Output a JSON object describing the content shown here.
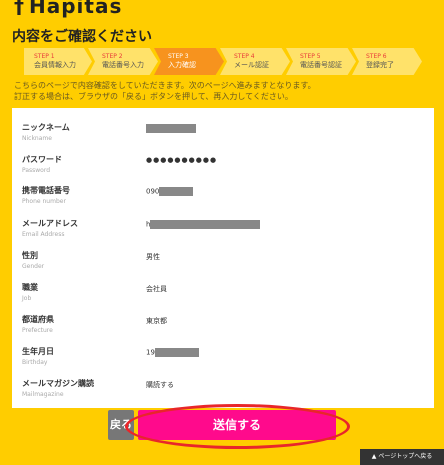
{
  "header": {
    "logo_mark": "†",
    "logo_text": "Hapitas",
    "page_title": "内容をご確認ください"
  },
  "steps": [
    {
      "num": "STEP 1",
      "label": "会員情報入力"
    },
    {
      "num": "STEP 2",
      "label": "電話番号入力"
    },
    {
      "num": "STEP 3",
      "label": "入力確認"
    },
    {
      "num": "STEP 4",
      "label": "メール認証"
    },
    {
      "num": "STEP 5",
      "label": "電話番号認証"
    },
    {
      "num": "STEP 6",
      "label": "登録完了"
    }
  ],
  "notice": {
    "line1": "こちらのページで内容確認をしていただきます。次のページへ進みますとなります。",
    "line2": "訂正する場合は、ブラウザの「戻る」ボタンを押して、再入力してください。"
  },
  "form": {
    "rows": [
      {
        "label": "ニックネーム",
        "sub": "Nickname",
        "value": ""
      },
      {
        "label": "パスワード",
        "sub": "Password",
        "value": "●●●●●●●●●●"
      },
      {
        "label": "携帯電話番号",
        "sub": "Phone number",
        "value": "090"
      },
      {
        "label": "メールアドレス",
        "sub": "Email Address",
        "value": "h"
      },
      {
        "label": "性別",
        "sub": "Gender",
        "value": "男性"
      },
      {
        "label": "職業",
        "sub": "Job",
        "value": "会社員"
      },
      {
        "label": "都道府県",
        "sub": "Prefecture",
        "value": "東京都"
      },
      {
        "label": "生年月日",
        "sub": "Birthday",
        "value": "19"
      },
      {
        "label": "メールマガジン購読",
        "sub": "Mailmagazine",
        "value": "購読する"
      }
    ]
  },
  "buttons": {
    "back_label": "戻る",
    "send_label": "送信する",
    "pagetop_label": "▲ ページトップへ戻る"
  },
  "colors": {
    "background": "#ffcd00",
    "send_button": "#ff0a8c",
    "active_step": "#f7931e",
    "highlight_ring": "#e8262a"
  }
}
